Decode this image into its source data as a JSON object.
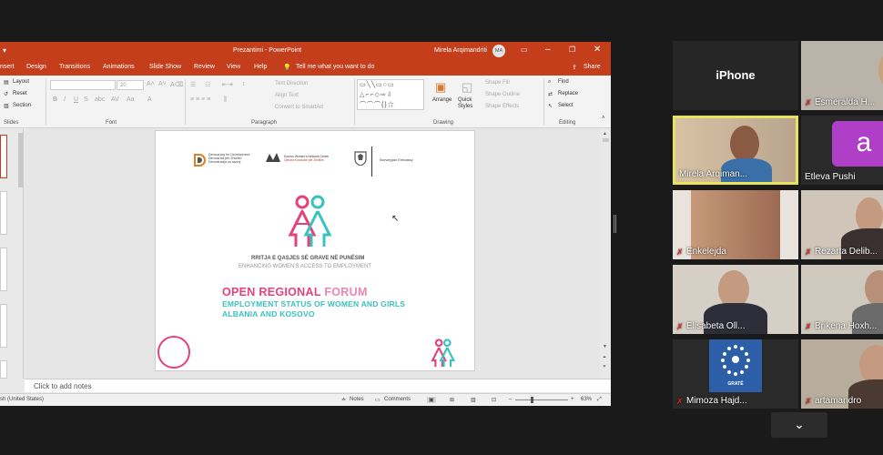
{
  "ppt": {
    "title": "Prezantimi  -  PowerPoint",
    "user": "Mirela Arqimandriti",
    "user_initials": "MA",
    "tabs": [
      "nsert",
      "Design",
      "Transitions",
      "Animations",
      "Slide Show",
      "Review",
      "View",
      "Help"
    ],
    "tell_me": "Tell me what you want to do",
    "share": "Share",
    "ribbon": {
      "slides_group": "Slides",
      "layout": "Layout",
      "reset": "Reset",
      "section": "Section",
      "font_group": "Font",
      "font_size": "20",
      "paragraph_group": "Paragraph",
      "text_direction": "Text Direction",
      "align_text": "Align Text",
      "convert_smartart": "Convert to SmartArt",
      "drawing_group": "Drawing",
      "arrange": "Arrange",
      "quick_styles": "Quick Styles",
      "shape_fill": "Shape Fill",
      "shape_outline": "Shape Outline",
      "shape_effects": "Shape Effects",
      "editing_group": "Editing",
      "find": "Find",
      "replace": "Replace",
      "select": "Select"
    },
    "notes_placeholder": "Click to add notes",
    "status": {
      "language": "sh (United States)",
      "notes": "Notes",
      "comments": "Comments",
      "zoom": "63%"
    },
    "slide": {
      "logo1_lines": [
        "Democracy for Development",
        "Demokraci për Zhvillim",
        "Demokracija za razvoj"
      ],
      "logo2_lines": [
        "Kosovo Women's Network Center",
        "Qendra Kosovare për Zhvillim"
      ],
      "logo3": "Norwegian Embassy",
      "title_al": "RRITJA E QASJES SË GRAVE NË PUNËSIM",
      "title_en": "ENHANCING WOMEN'S ACCESS TO EMPLOYMENT",
      "forum_part1": "OPEN REGIONAL",
      "forum_part2": "FORUM",
      "sub1": "EMPLOYMENT STATUS OF WOMEN AND GIRLS",
      "sub2": "ALBANIA AND KOSOVO"
    }
  },
  "zoom": {
    "participants": [
      {
        "name": "iPhone"
      },
      {
        "name": "Esmeralda H..."
      },
      {
        "name": "Mirela Arqiman..."
      },
      {
        "name": "Etleva Pushi",
        "avatar": "a"
      },
      {
        "name": "Enkelejda"
      },
      {
        "name": "Rezarta Delib..."
      },
      {
        "name": "Elisabeta Oll..."
      },
      {
        "name": "Brikena Hoxh..."
      },
      {
        "name": "Mimoza Hajd..."
      },
      {
        "name": "artamandro"
      }
    ],
    "tile_logo_text": "GRATË"
  },
  "colors": {
    "ppt_red": "#c43e1c",
    "active_speaker": "#e8e35a",
    "slide_pink": "#e6427a",
    "slide_teal": "#38c2c0"
  }
}
